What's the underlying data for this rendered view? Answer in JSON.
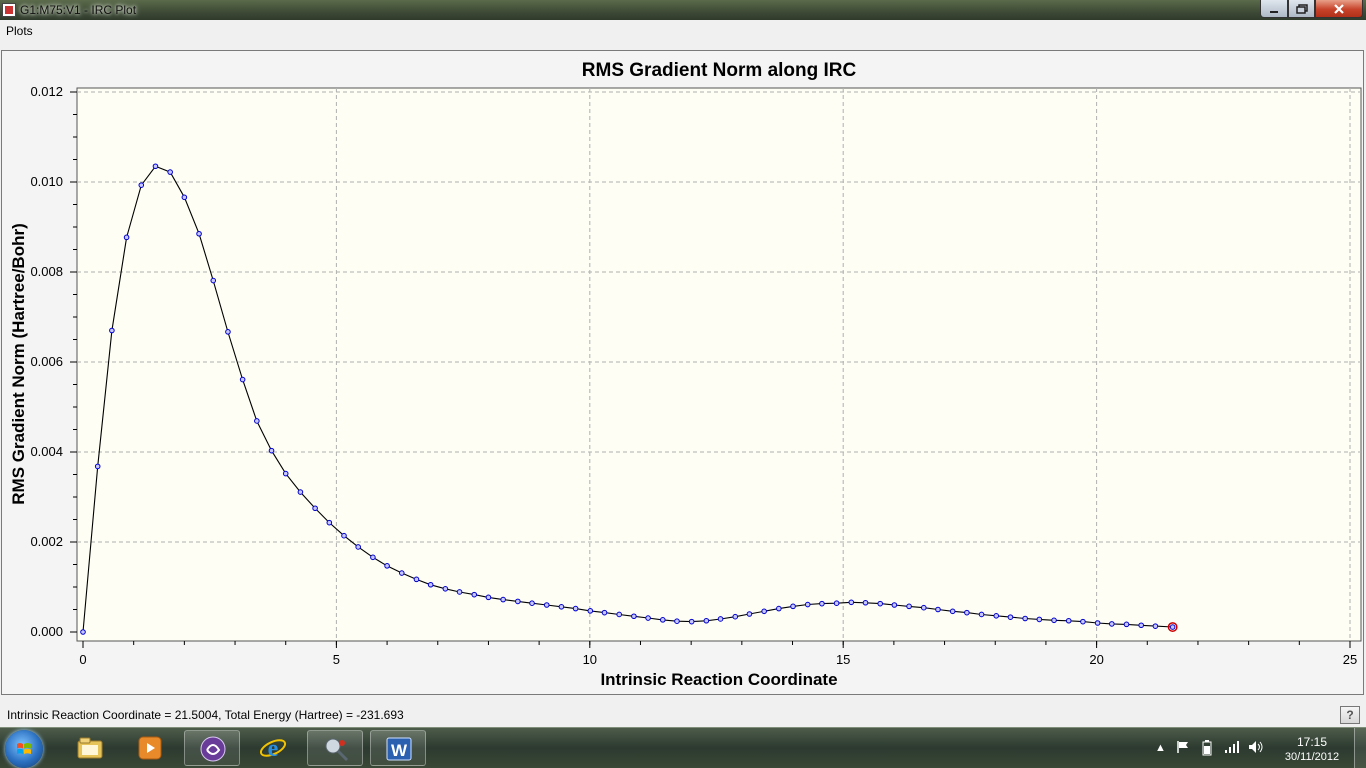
{
  "window": {
    "title": "G1:M75:V1 - IRC Plot",
    "buttons": {
      "minimize": "minimize-icon",
      "maximize": "restore-icon",
      "close": "close-icon"
    }
  },
  "menu": {
    "items": [
      "Plots"
    ]
  },
  "status": {
    "text": "Intrinsic Reaction Coordinate = 21.5004, Total Energy (Hartree) = -231.693",
    "help_label": "?"
  },
  "taskbar": {
    "apps": [
      {
        "icon": "windows-explorer-icon"
      },
      {
        "icon": "media-player-icon"
      },
      {
        "icon": "bittorrent-icon"
      },
      {
        "icon": "internet-explorer-icon"
      },
      {
        "icon": "gaussview-icon"
      },
      {
        "icon": "word-icon",
        "label": "W"
      }
    ],
    "clock": {
      "time": "17:15",
      "date": "30/11/2012"
    }
  },
  "colors": {
    "plot_background": "#fefef5",
    "curve": "#000000",
    "marker": "#0000cc",
    "marker_fill": "#c8c8ff",
    "current_point": "#cc0000",
    "grid": "#b0b0b0"
  },
  "chart_data": {
    "type": "line",
    "title": "RMS Gradient Norm along IRC",
    "xlabel": "Intrinsic Reaction Coordinate",
    "ylabel": "RMS Gradient Norm (Hartree/Bohr)",
    "xlim": [
      0,
      25
    ],
    "ylim": [
      0,
      0.012
    ],
    "xticks": [
      0,
      5,
      10,
      15,
      20,
      25
    ],
    "yticks": [
      0.0,
      0.002,
      0.004,
      0.006,
      0.008,
      0.01,
      0.012
    ],
    "ytick_labels": [
      "0.000",
      "0.002",
      "0.004",
      "0.006",
      "0.008",
      "0.010",
      "0.012"
    ],
    "grid": true,
    "series": [
      {
        "x": [
          0,
          0.29,
          0.57,
          0.86,
          1.15,
          1.43,
          1.72,
          2.0,
          2.29,
          2.57,
          2.86,
          3.15,
          3.43,
          3.72,
          4.0,
          4.29,
          4.58,
          4.86,
          5.15,
          5.43,
          5.72,
          6.0,
          6.29,
          6.58,
          6.86,
          7.15,
          7.43,
          7.72,
          8.0,
          8.29,
          8.58,
          8.86,
          9.15,
          9.44,
          9.72,
          10.01,
          10.29,
          10.58,
          10.87,
          11.15,
          11.44,
          11.72,
          12.01,
          12.3,
          12.58,
          12.87,
          13.15,
          13.44,
          13.73,
          14.01,
          14.3,
          14.58,
          14.87,
          15.16,
          15.44,
          15.73,
          16.01,
          16.3,
          16.59,
          16.87,
          17.16,
          17.44,
          17.73,
          18.02,
          18.3,
          18.59,
          18.87,
          19.16,
          19.45,
          19.73,
          20.02,
          20.3,
          20.59,
          20.88,
          21.16,
          21.5
        ],
        "y": [
          0.0,
          0.00368,
          0.0067,
          0.00877,
          0.00993,
          0.01035,
          0.01022,
          0.00966,
          0.00885,
          0.00781,
          0.00667,
          0.00561,
          0.00469,
          0.00403,
          0.00352,
          0.00311,
          0.00275,
          0.00243,
          0.00214,
          0.00189,
          0.00166,
          0.00147,
          0.00131,
          0.00117,
          0.00105,
          0.00096,
          0.00089,
          0.00083,
          0.00077,
          0.00072,
          0.00068,
          0.00064,
          0.0006,
          0.00056,
          0.00052,
          0.00047,
          0.00043,
          0.00039,
          0.00035,
          0.00031,
          0.00027,
          0.00024,
          0.00023,
          0.00025,
          0.00029,
          0.00034,
          0.0004,
          0.00046,
          0.00052,
          0.00057,
          0.00061,
          0.00063,
          0.00064,
          0.00066,
          0.00065,
          0.00063,
          0.0006,
          0.00057,
          0.00054,
          0.0005,
          0.00046,
          0.00043,
          0.00039,
          0.00036,
          0.00033,
          0.0003,
          0.00028,
          0.00026,
          0.00025,
          0.00023,
          0.0002,
          0.00018,
          0.00017,
          0.00015,
          0.00013,
          0.00011
        ]
      }
    ],
    "current_point": {
      "x": 21.5004,
      "y": 0.00011
    }
  }
}
